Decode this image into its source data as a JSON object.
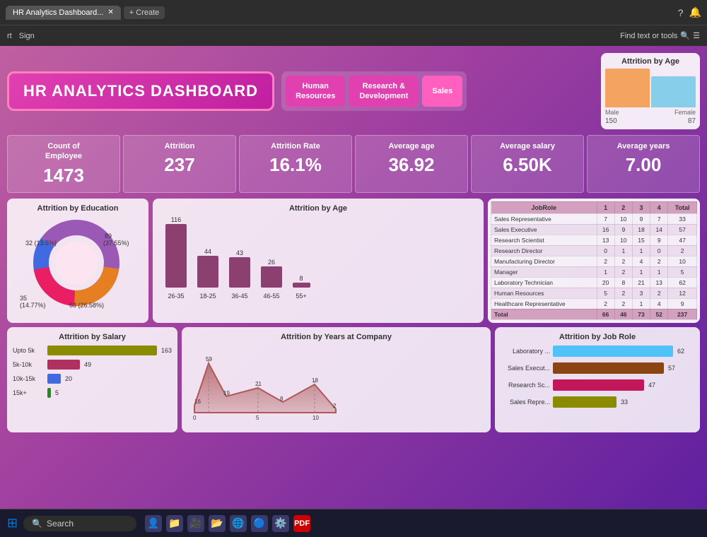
{
  "browser": {
    "tab_label": "HR Analytics Dashboard...",
    "new_tab_label": "+ Create",
    "nav_link1": "rt",
    "nav_link2": "Sign",
    "find_tools": "Find text or tools"
  },
  "dashboard": {
    "title": "HR ANALYTICS DASHBOARD",
    "dept_buttons": [
      "Human Resources",
      "Research & Development",
      "Sales"
    ],
    "attrition_age_title": "Attrition by Age",
    "age_male_count": "150",
    "age_female_count": "87",
    "age_male_label": "Male",
    "age_female_label": "Female"
  },
  "kpis": [
    {
      "label": "Count of Employee",
      "value": "1473"
    },
    {
      "label": "Attrition",
      "value": "237"
    },
    {
      "label": "Attrition Rate",
      "value": "16.1%"
    },
    {
      "label": "Average age",
      "value": "36.92"
    },
    {
      "label": "Average salary",
      "value": "6.50K"
    },
    {
      "label": "Average years",
      "value": "7.00"
    }
  ],
  "education_chart": {
    "title": "Attrition by Education",
    "segments": [
      {
        "label": "89 (37.55%)",
        "color": "#4169E1"
      },
      {
        "label": "63 (26.58%)",
        "color": "#9B59B6"
      },
      {
        "label": "35 (14.77%)",
        "color": "#E67E22"
      },
      {
        "label": "32 (13.5%)",
        "color": "#E91E63"
      }
    ]
  },
  "age_chart": {
    "title": "Attrition by Age",
    "bars": [
      {
        "label": "26-35",
        "value": 116
      },
      {
        "label": "18-25",
        "value": 44
      },
      {
        "label": "36-45",
        "value": 43
      },
      {
        "label": "46-55",
        "value": 26
      },
      {
        "label": "55+",
        "value": 8
      }
    ]
  },
  "job_table": {
    "title": "JobRole",
    "columns": [
      "1",
      "2",
      "3",
      "4",
      "Total"
    ],
    "rows": [
      {
        "role": "Sales Representative",
        "vals": [
          7,
          10,
          9,
          7,
          33
        ]
      },
      {
        "role": "Sales Executive",
        "vals": [
          16,
          9,
          18,
          14,
          57
        ]
      },
      {
        "role": "Research Scientist",
        "vals": [
          13,
          10,
          15,
          9,
          47
        ]
      },
      {
        "role": "Research Director",
        "vals": [
          0,
          1,
          1,
          0,
          2
        ]
      },
      {
        "role": "Manufacturing Director",
        "vals": [
          2,
          2,
          4,
          2,
          10
        ]
      },
      {
        "role": "Manager",
        "vals": [
          1,
          2,
          1,
          1,
          5
        ]
      },
      {
        "role": "Laboratory Technician",
        "vals": [
          20,
          8,
          21,
          13,
          62
        ]
      },
      {
        "role": "Human Resources",
        "vals": [
          5,
          2,
          3,
          2,
          12
        ]
      },
      {
        "role": "Healthcare Representative",
        "vals": [
          2,
          2,
          1,
          4,
          9
        ]
      },
      {
        "role": "Total",
        "vals": [
          66,
          46,
          73,
          52,
          237
        ],
        "isTotal": true
      }
    ]
  },
  "salary_chart": {
    "title": "Attrition by Salary",
    "bars": [
      {
        "label": "Upto 5k",
        "value": 163,
        "color": "#8B8B00",
        "pct": 100
      },
      {
        "label": "5k-10k",
        "value": 49,
        "color": "#B03060",
        "pct": 30
      },
      {
        "label": "10k-15k",
        "value": 20,
        "color": "#4169E1",
        "pct": 12
      },
      {
        "label": "15k+",
        "value": 5,
        "color": "#228B22",
        "pct": 3
      }
    ]
  },
  "years_chart": {
    "title": "Attrition by Years at Company",
    "points": [
      {
        "x": 0,
        "y": 16,
        "label": "16"
      },
      {
        "x": 1,
        "y": 59,
        "label": "59"
      },
      {
        "x": 2,
        "y": 19,
        "label": "19"
      },
      {
        "x": 5,
        "y": 21,
        "label": "21"
      },
      {
        "x": 7,
        "y": 8,
        "label": "8"
      },
      {
        "x": 10,
        "y": 18,
        "label": "18"
      },
      {
        "x": 11,
        "y": 2,
        "label": "2"
      }
    ]
  },
  "jobrole_chart": {
    "title": "Attrition by Job Role",
    "bars": [
      {
        "label": "Laboratory ...",
        "value": 62,
        "color": "#4FC3F7",
        "pct": 100
      },
      {
        "label": "Sales Execut...",
        "value": 57,
        "color": "#8B4513",
        "pct": 92
      },
      {
        "label": "Research Sc...",
        "value": 47,
        "color": "#C2185B",
        "pct": 76
      },
      {
        "label": "Sales Repre...",
        "value": 33,
        "color": "#8B8B00",
        "pct": 53
      }
    ]
  },
  "taskbar": {
    "search_placeholder": "Search"
  }
}
